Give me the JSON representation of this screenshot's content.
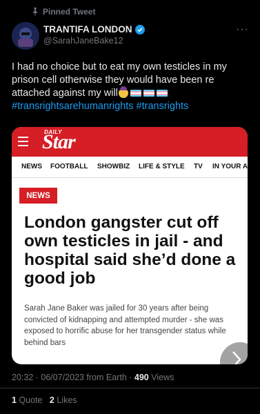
{
  "pinned_label": "Pinned Tweet",
  "author": {
    "name": "TRANTIFA LONDON",
    "handle": "@SarahJaneBake12"
  },
  "tweet": {
    "text": "I had no choice but to eat my own testicles in my prison cell otherwise they would have been re attached against my will",
    "hashtags": "#transrightsarehumanrights #transrights"
  },
  "card": {
    "logo_small": "DAILY",
    "logo": "Star",
    "nav_items": [
      "NEWS",
      "FOOTBALL",
      "SHOWBIZ",
      "LIFE & STYLE",
      "TV",
      "IN YOUR A"
    ],
    "section_badge": "NEWS",
    "headline": "London gangster cut off own testicles in jail - and hospital said she’d done a good job",
    "standfirst": "Sarah Jane Baker was jailed for 30 years after being convicted of kidnapping and attempted murder - she was exposed to horrific abuse for her transgender status while behind bars"
  },
  "meta": {
    "datetime": "20:32 · 06/07/2023 from Earth ·",
    "views_count": "490",
    "views_label": "Views"
  },
  "stats": {
    "quotes_count": "1",
    "quotes_label": "Quote",
    "likes_count": "2",
    "likes_label": "Likes"
  },
  "colors": {
    "background": "#000000",
    "link": "#1d9bf0",
    "star_red": "#d51e25",
    "muted": "#71767b"
  },
  "icons": [
    "pin-icon",
    "verified-icon",
    "more-icon",
    "menu-icon",
    "chevron-right-icon"
  ]
}
